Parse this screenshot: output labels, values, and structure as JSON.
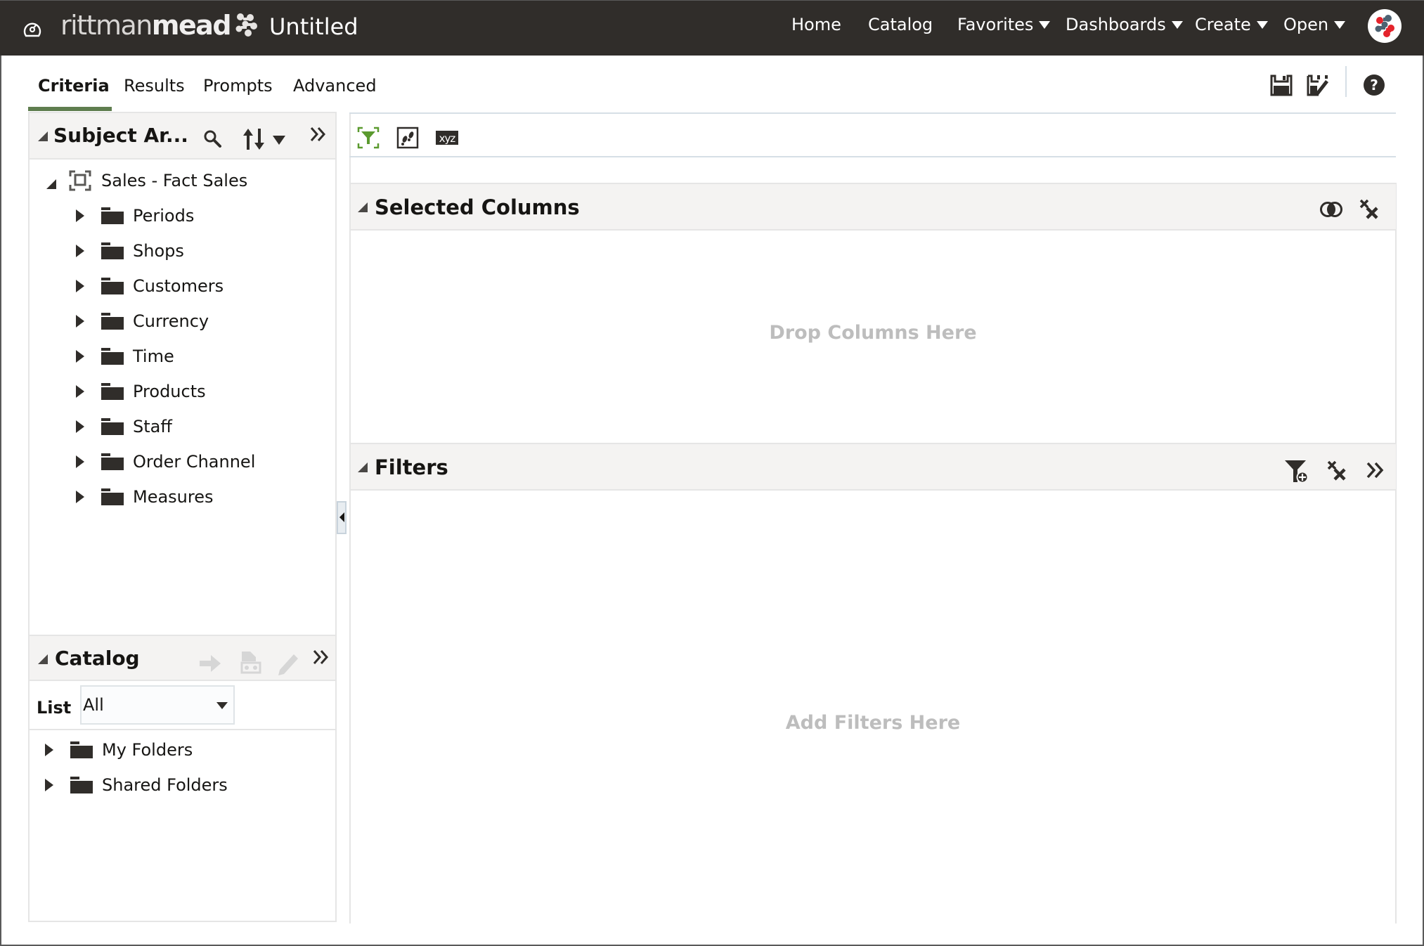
{
  "header": {
    "brand_light": "rittman",
    "brand_bold": "mead",
    "document_title": "Untitled",
    "nav": [
      {
        "label": "Home",
        "has_menu": false
      },
      {
        "label": "Catalog",
        "has_menu": false
      },
      {
        "label": "Favorites",
        "has_menu": true
      },
      {
        "label": "Dashboards",
        "has_menu": true
      },
      {
        "label": "Create",
        "has_menu": true
      },
      {
        "label": "Open",
        "has_menu": true
      }
    ],
    "icons": {
      "home": "dashboard-gauge-icon",
      "brand_mark": "rittmanmead-molecule-icon",
      "user": "user-avatar-icon"
    }
  },
  "tabs": [
    {
      "label": "Criteria",
      "active": true
    },
    {
      "label": "Results",
      "active": false
    },
    {
      "label": "Prompts",
      "active": false
    },
    {
      "label": "Advanced",
      "active": false
    }
  ],
  "tab_accent_color": "#5f7d4f",
  "top_actions": [
    {
      "icon": "save-icon",
      "label": "Save"
    },
    {
      "icon": "save-as-icon",
      "label": "Save As"
    },
    {
      "icon": "help-icon",
      "label": "Help"
    }
  ],
  "subject_areas": {
    "title": "Subject Ar...",
    "icons": [
      "search-icon",
      "sort-icon",
      "chevron-down-icon",
      "collapse-pane-icon"
    ],
    "root": {
      "label": "Sales - Fact Sales",
      "expanded": true
    },
    "folders": [
      "Periods",
      "Shops",
      "Customers",
      "Currency",
      "Time",
      "Products",
      "Staff",
      "Order Channel",
      "Measures"
    ]
  },
  "catalog": {
    "title": "Catalog",
    "icons": [
      "move-icon",
      "properties-icon",
      "edit-icon",
      "collapse-pane-icon"
    ],
    "list_label": "List",
    "list_value": "All",
    "folders": [
      "My Folders",
      "Shared Folders"
    ]
  },
  "criteria_toolbar": [
    {
      "icon": "filter-toggle-icon",
      "label": "Show/Hide Filters",
      "color": "#5b9a2f"
    },
    {
      "icon": "steps-icon",
      "label": "Show/Hide Selection Steps"
    },
    {
      "icon": "xyz-icon",
      "label": "Column Properties",
      "text": "xyz"
    }
  ],
  "selected_columns": {
    "title": "Selected Columns",
    "placeholder": "Drop Columns Here",
    "icons": [
      "combine-results-icon",
      "remove-all-icon"
    ]
  },
  "filters": {
    "title": "Filters",
    "placeholder": "Add Filters Here",
    "icons": [
      "add-filter-icon",
      "delete-filters-icon",
      "more-options-icon"
    ]
  }
}
